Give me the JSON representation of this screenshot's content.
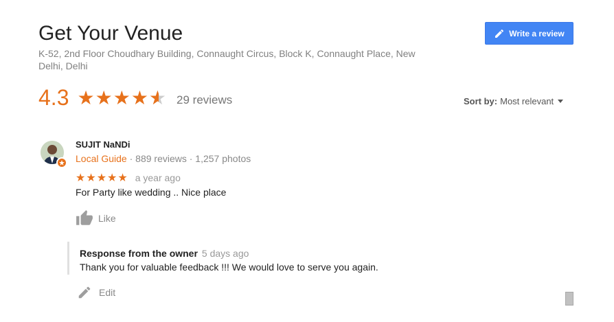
{
  "business": {
    "name": "Get Your Venue",
    "address": "K-52, 2nd Floor Choudhary Building, Connaught Circus, Block K, Connaught Place, New Delhi, Delhi",
    "rating": "4.3",
    "rating_value": 4.3,
    "review_count": "29 reviews",
    "write_review_label": "Write a review"
  },
  "sort": {
    "label": "Sort by:",
    "value": "Most relevant"
  },
  "review": {
    "author": "SUJIT NaNDi",
    "guide_label": "Local Guide",
    "meta": " · 889 reviews · 1,257 photos",
    "stars": "★★★★★",
    "rating_value": 5,
    "time": "a year ago",
    "text": "For Party like wedding .. Nice place",
    "like_label": "Like"
  },
  "owner_response": {
    "heading": "Response from the owner",
    "time": "5 days ago",
    "text": "Thank you for valuable feedback !!! We would love to serve you again.",
    "edit_label": "Edit"
  },
  "colors": {
    "accent_orange": "#e7711b",
    "button_blue": "#4285f4",
    "muted_gray": "#808080"
  }
}
